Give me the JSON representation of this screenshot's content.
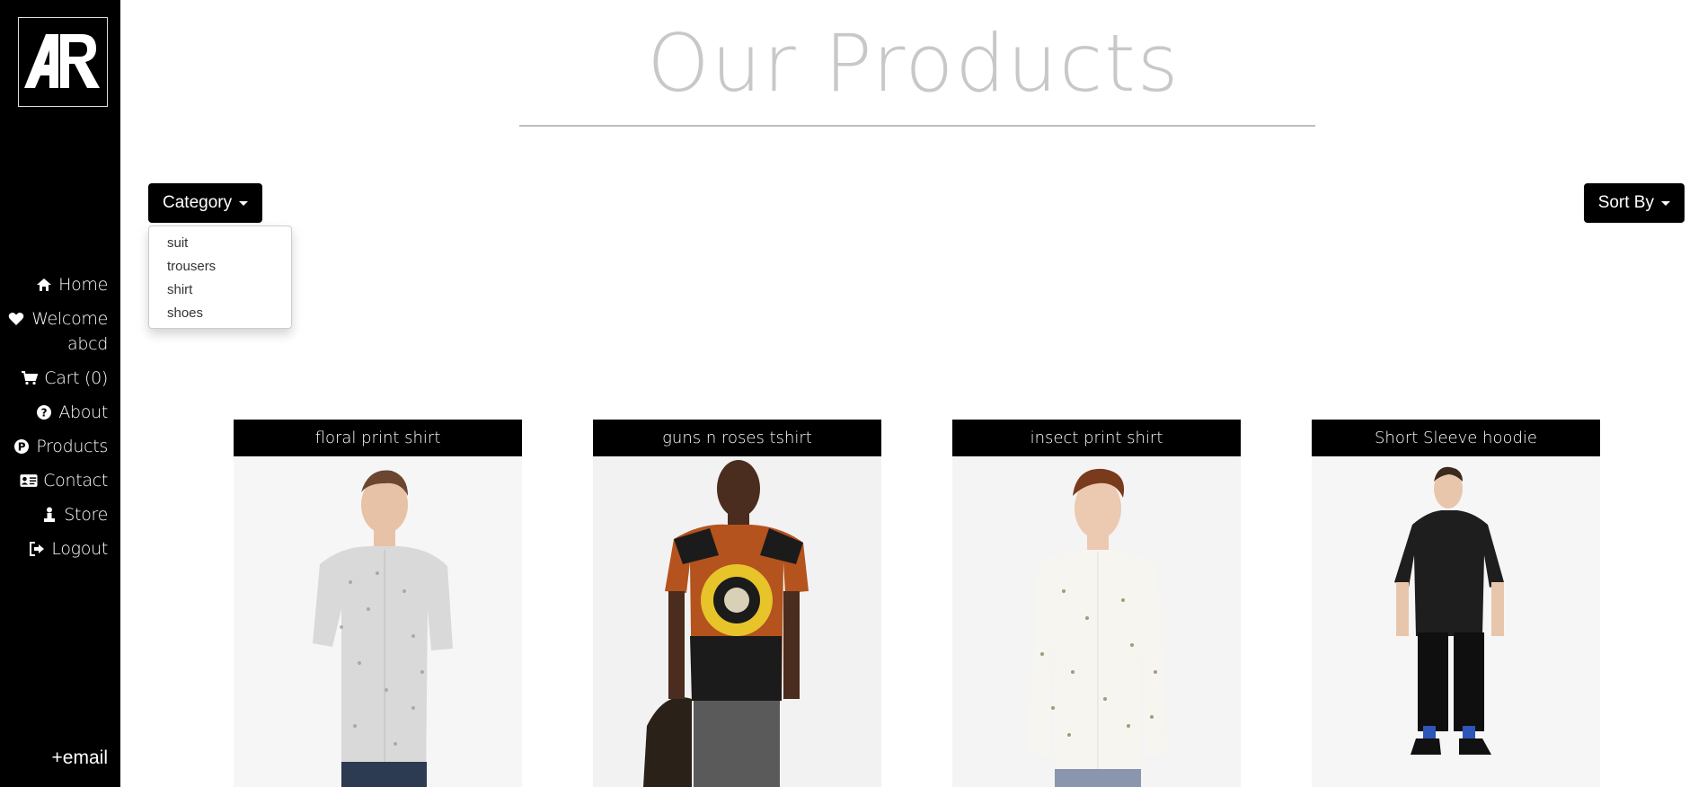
{
  "page": {
    "title": "Our Products"
  },
  "sidebar": {
    "logo_text": "AR",
    "items": [
      {
        "label": "Home",
        "icon": "home-icon"
      },
      {
        "label": "Welcome abcd",
        "icon": "heart-icon"
      },
      {
        "label": "Cart (0)",
        "icon": "cart-icon"
      },
      {
        "label": "About",
        "icon": "question-circle-icon"
      },
      {
        "label": "Products",
        "icon": "product-p-icon"
      },
      {
        "label": "Contact",
        "icon": "contact-card-icon"
      },
      {
        "label": "Store",
        "icon": "store-person-icon"
      },
      {
        "label": "Logout",
        "icon": "logout-icon"
      }
    ],
    "email_label": "+email"
  },
  "filters": {
    "category_label": "Category",
    "sort_label": "Sort By",
    "category_options": [
      "suit",
      "trousers",
      "shirt",
      "shoes"
    ]
  },
  "products": [
    {
      "title": "floral print shirt",
      "colors": {
        "shirt": "#d9d9d9",
        "pants": "#2c3a52",
        "skin": "#e7c2a6"
      }
    },
    {
      "title": "guns n roses tshirt",
      "colors": {
        "shirt": "#1b1b1b",
        "accent": "#b4531d",
        "pants": "#5a5a5a",
        "skin": "#4a2d1f"
      }
    },
    {
      "title": "insect print shirt",
      "colors": {
        "shirt": "#f7f5f0",
        "pants": "#8a96ad",
        "skin": "#ecc9b1"
      }
    },
    {
      "title": "Short Sleeve hoodie",
      "colors": {
        "shirt": "#1e1e1e",
        "pants": "#0f0f0f",
        "skin": "#e8c6ac"
      }
    }
  ]
}
